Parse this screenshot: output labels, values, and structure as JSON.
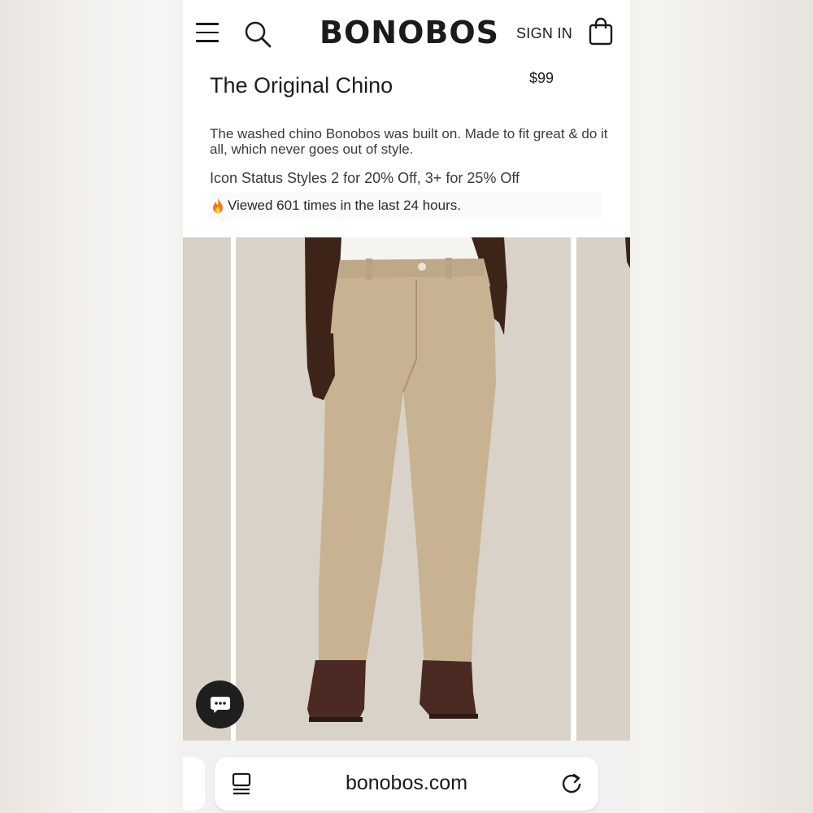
{
  "header": {
    "brand": "BONOBOS",
    "sign_in_label": "SIGN IN",
    "icons": {
      "menu": "hamburger-icon",
      "search": "search-icon",
      "bag": "shopping-bag-icon"
    }
  },
  "product": {
    "title": "The Original Chino",
    "price": "$99",
    "description": "The washed chino Bonobos was built on. Made to fit great & do it all, which never goes out of style.",
    "promo": "Icon Status Styles 2 for 20% Off, 3+ for 25% Off",
    "viewed": "Viewed 601 times in the last 24 hours.",
    "viewed_icon": "fire-icon"
  },
  "gallery": {
    "images": [
      "model-wearing-khaki-chinos"
    ],
    "pant_color": "#c7b291",
    "background_color": "#d8d2c8"
  },
  "chat": {
    "icon": "chat-bubble-icon"
  },
  "browser": {
    "url": "bonobos.com",
    "icons": {
      "tabs": "tabs-icon",
      "reload": "reload-icon"
    }
  }
}
